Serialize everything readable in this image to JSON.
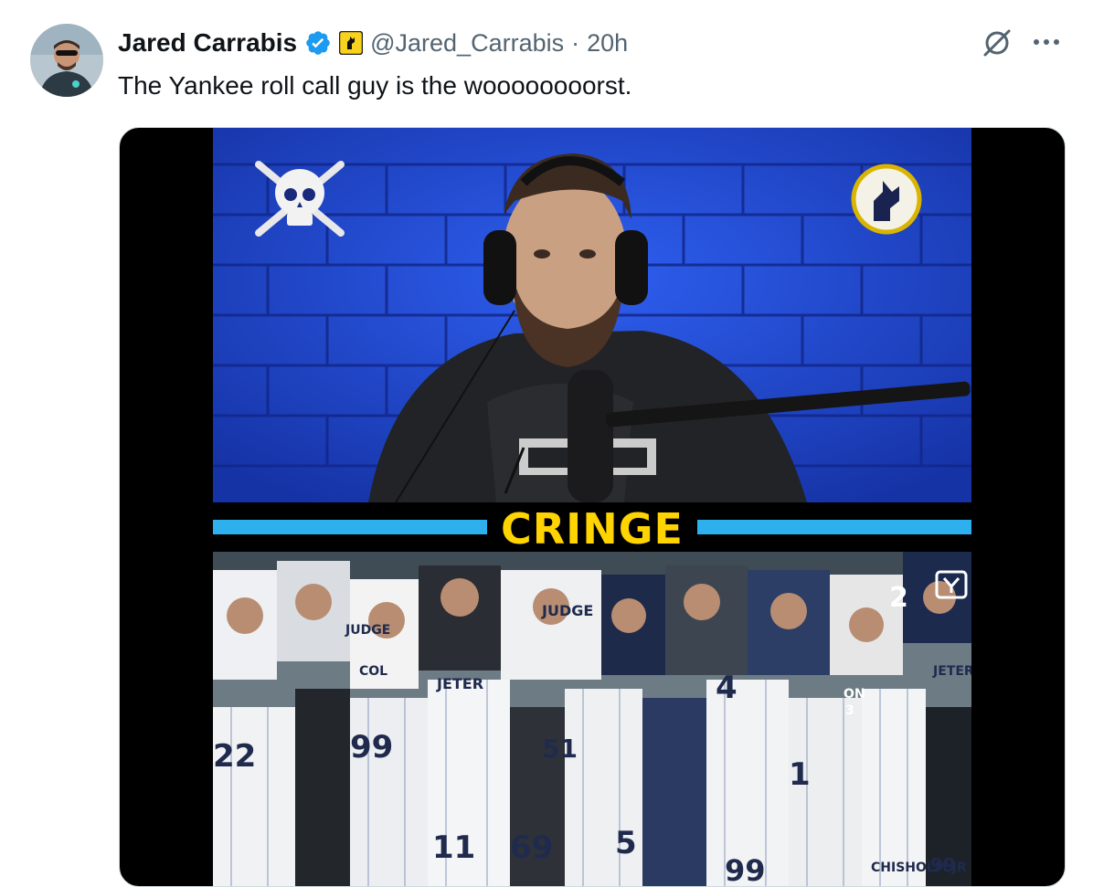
{
  "author": {
    "name": "Jared Carrabis",
    "handle": "@Jared_Carrabis",
    "separator": "·",
    "time": "20h"
  },
  "tweet": {
    "text": "The Yankee roll call guy is the woooooooorst."
  },
  "video": {
    "caption": "CRINGE",
    "jersey_texts": [
      "JUDGE",
      "JETER",
      "JUDGE",
      "JETER",
      "COL",
      "22",
      "99",
      "51",
      "11",
      "69",
      "5",
      "4",
      "1",
      "2",
      "99",
      "CHISHOLM JR",
      "99",
      "ON",
      "3"
    ]
  },
  "colors": {
    "verified": "#1d9bf0",
    "affiliate": "#f8d21c",
    "caption": "#ffd400",
    "stripe": "#2fb0ee",
    "studio_wall": "#1f47c7"
  },
  "icons": {
    "verified": "verified-badge-icon",
    "affiliate": "barstool-affiliate-icon",
    "grok": "grok-icon",
    "more": "more-icon"
  }
}
